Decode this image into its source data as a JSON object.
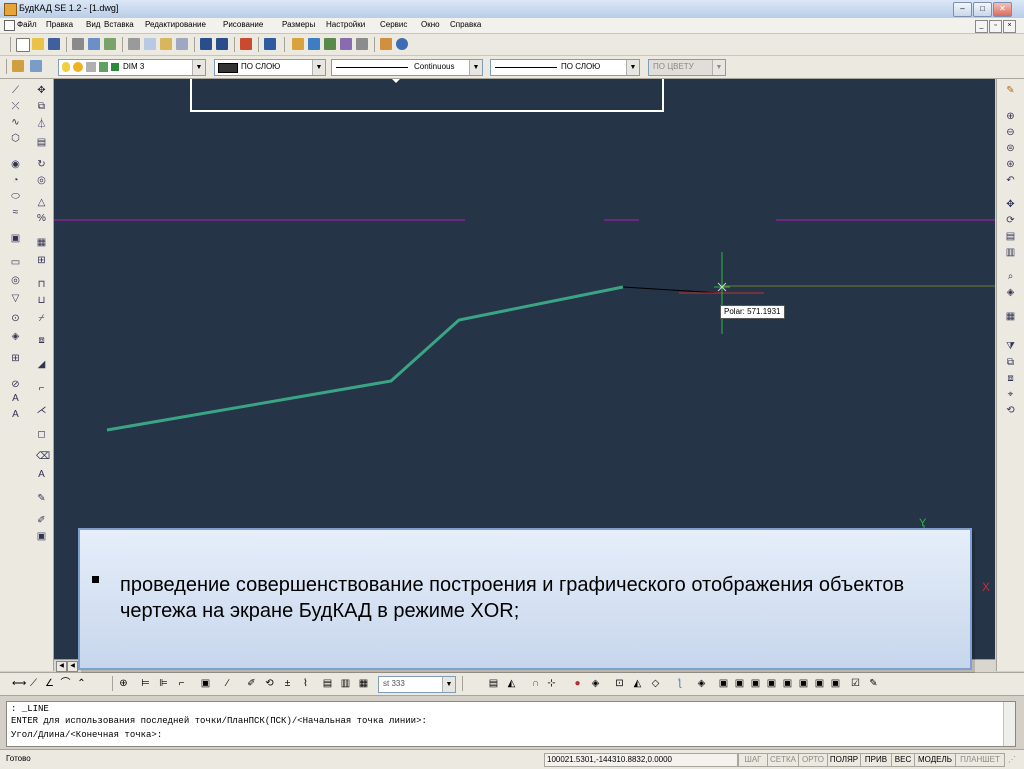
{
  "titlebar": {
    "title": "БудКАД SE 1.2 - [1.dwg]",
    "minimize": "–",
    "maximize": "□",
    "close": "✕"
  },
  "menubar": {
    "items": [
      "Файл",
      "Правка",
      "Вид",
      "Вставка",
      "Редактирование",
      "Рисование",
      "Размеры",
      "Настройки",
      "Сервис",
      "Окно",
      "Справка"
    ],
    "mdi": {
      "minimize": "_",
      "restore": "▫",
      "close": "×"
    }
  },
  "toolbar2": {
    "layer": "DIM 3",
    "color": "ПО СЛОЮ",
    "linetype": "Continuous",
    "lineweight": "ПО СЛОЮ",
    "plotstyle": "ПО ЦВЕТУ"
  },
  "drawing": {
    "background": "#253447",
    "polyline_color": "#3aa585",
    "tooltip": "Polar: 571.1931",
    "axis_label": "Y",
    "axis_x_label": "X"
  },
  "tabs": {
    "visible_text": "…"
  },
  "bottomtoolbar": {
    "dim_style": "st 333"
  },
  "command": {
    "lines": [
      ": _LINE",
      "ENTER для использования последней точки/ПланПСК(ПСК)/<Начальная точка линии>:",
      "Угол/Длина/<Конечная точка>:"
    ]
  },
  "statusbar": {
    "status": "Готово",
    "coords": "100021.5301,-144310.8832,0.0000",
    "toggles": [
      {
        "label": "ШАГ",
        "on": false
      },
      {
        "label": "СЕТКА",
        "on": false
      },
      {
        "label": "ОРТО",
        "on": false
      },
      {
        "label": "ПОЛЯР",
        "on": true
      },
      {
        "label": "ПРИВ",
        "on": true
      },
      {
        "label": "ВЕС",
        "on": true
      },
      {
        "label": "МОДЕЛЬ",
        "on": true
      },
      {
        "label": "ПЛАНШЕТ",
        "on": false
      }
    ]
  },
  "overlay": {
    "text": "проведение совершенствование построения и графического отображения объектов чертежа на экране БудКАД в режиме XOR;"
  }
}
